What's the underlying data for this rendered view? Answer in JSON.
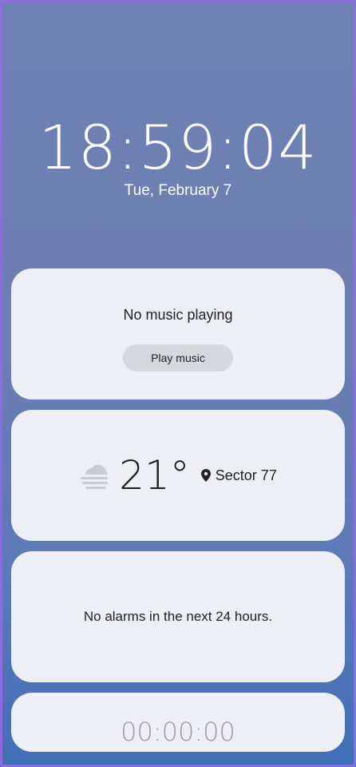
{
  "lockscreen": {
    "time": "18:59:04",
    "date": "Tue, February 7"
  },
  "music_card": {
    "status": "No music playing",
    "play_label": "Play music"
  },
  "weather_card": {
    "icon": "cloud-fog-icon",
    "temperature": "21°",
    "location_icon": "map-pin-icon",
    "location": "Sector 77"
  },
  "alarm_card": {
    "status": "No alarms in the next 24 hours."
  },
  "timer_card": {
    "value": "00:00:00"
  },
  "colors": {
    "card_bg": "#edeff4",
    "button_bg": "#d6d8de",
    "timer_text": "#9a9ca3"
  }
}
